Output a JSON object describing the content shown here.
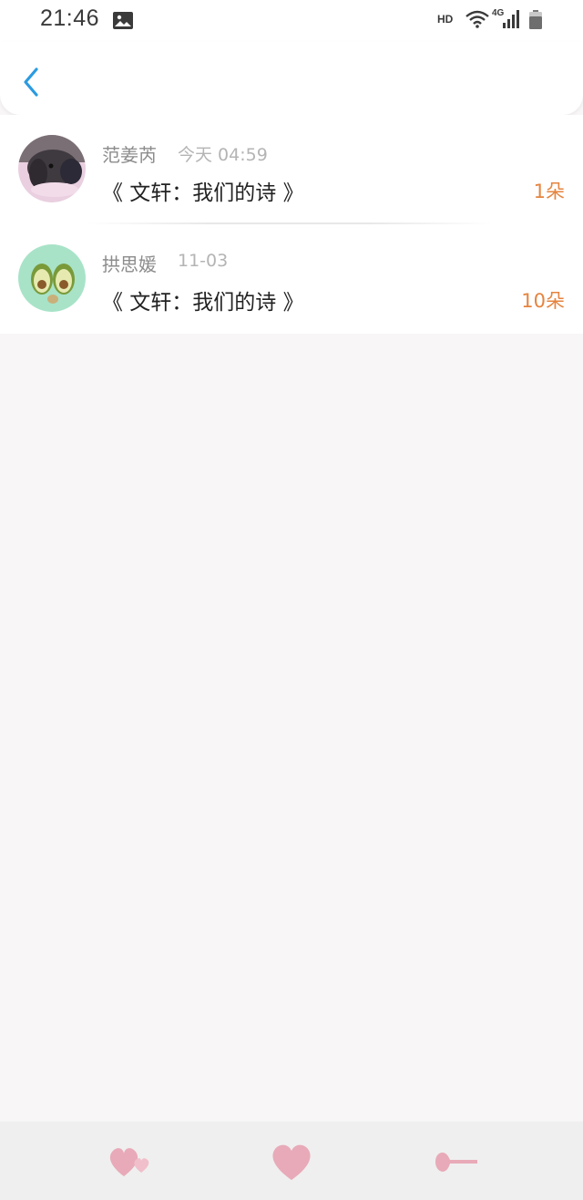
{
  "status_bar": {
    "time": "21:46",
    "hd_label": "HD",
    "network_label": "4G",
    "icons": [
      "gallery-icon",
      "wifi-icon",
      "signal-icon",
      "battery-icon"
    ]
  },
  "nav": {
    "back_icon": "chevron-left-icon",
    "accent_color": "#2b9be0"
  },
  "records": [
    {
      "name": "范姜芮",
      "time": "今天 04:59",
      "title": "《 文轩：我们的诗 》",
      "count": "1朵",
      "avatar": "bunny-avatar"
    },
    {
      "name": "拱思媛",
      "time": "11-03",
      "title": "《 文轩：我们的诗 》",
      "count": "10朵",
      "avatar": "avocado-avatar"
    }
  ],
  "bottom_bar": {
    "icons": [
      "double-heart-icon",
      "heart-icon",
      "arrow-back-icon"
    ],
    "icon_color": "#e8aab8"
  },
  "colors": {
    "count": "#e5843f",
    "name": "#8c8c8c",
    "time": "#b4b4b4",
    "title": "#222222",
    "background": "#f8f6f7"
  }
}
